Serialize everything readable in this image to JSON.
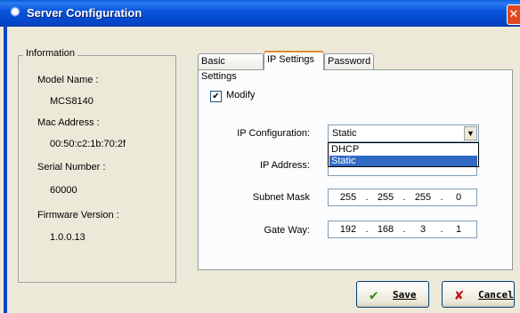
{
  "window": {
    "title": "Server Configuration",
    "close_glyph": "✕"
  },
  "info": {
    "legend": "Information",
    "model_label": "Model Name :",
    "model_value": "MCS8140",
    "mac_label": "Mac Address :",
    "mac_value": "00:50:c2:1b:70:2f",
    "serial_label": "Serial Number :",
    "serial_value": "60000",
    "firmware_label": "Firmware Version :",
    "firmware_value": "1.0.0.13"
  },
  "tabs": [
    "Basic Settings",
    "IP Settings",
    "Password"
  ],
  "active_tab": "IP Settings",
  "ip_settings": {
    "modify_label": "Modify",
    "modify_checked": true,
    "config_label": "IP Configuration:",
    "config_value": "Static",
    "config_options": [
      "DHCP",
      "Static"
    ],
    "ip_label": "IP Address:",
    "subnet_label": "Subnet Mask",
    "subnet": [
      "255",
      "255",
      "255",
      "0"
    ],
    "gateway_label": "Gate Way:",
    "gateway": [
      "192",
      "168",
      "3",
      "1"
    ]
  },
  "buttons": {
    "save": "Save",
    "cancel": "Cancel"
  },
  "icons": {
    "title": "gear-icon",
    "save": "check-icon",
    "cancel": "x-icon"
  }
}
